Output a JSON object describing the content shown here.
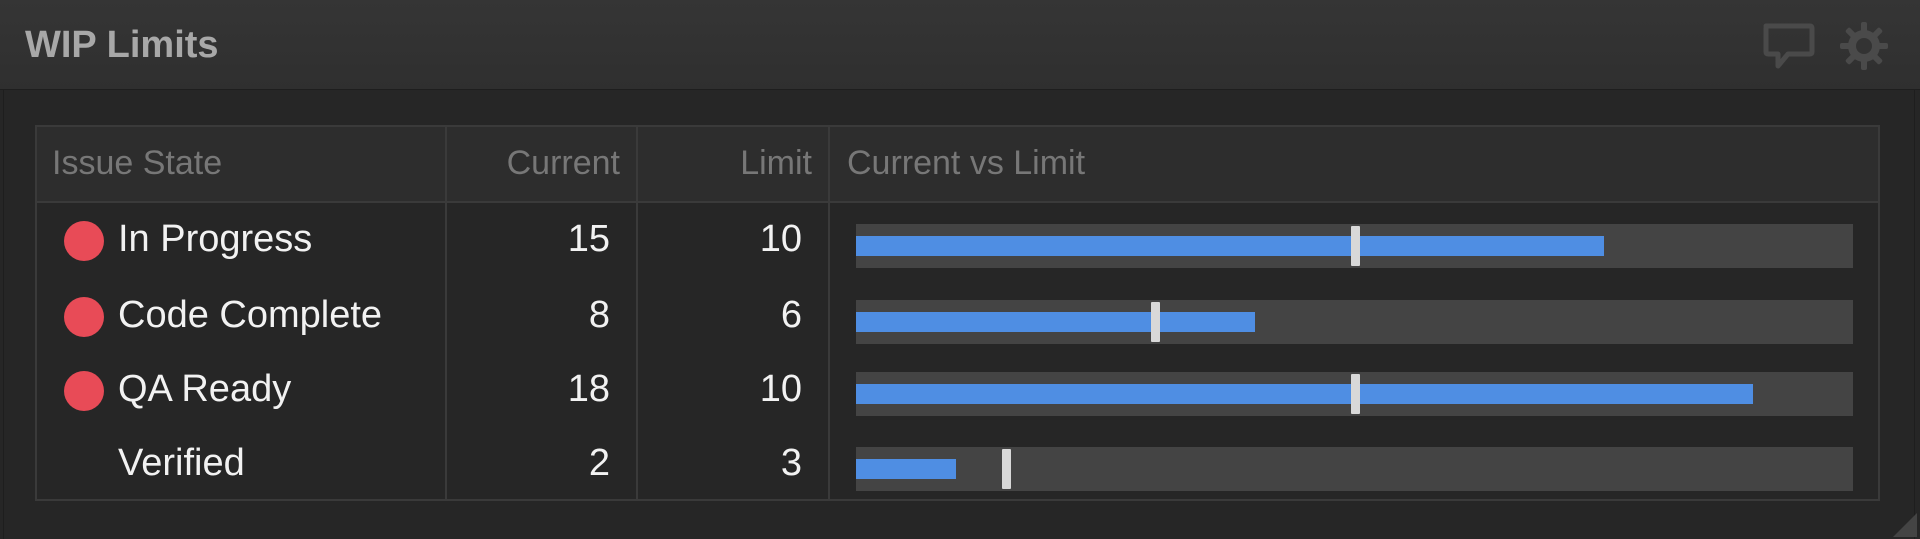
{
  "widget": {
    "title": "WIP Limits",
    "icons": {
      "comment": "comment-icon",
      "settings": "gear-icon"
    }
  },
  "table": {
    "headers": {
      "state": "Issue State",
      "current": "Current",
      "limit": "Limit",
      "bar": "Current vs Limit"
    },
    "rows": [
      {
        "state": "In Progress",
        "current": "15",
        "limit": "10",
        "over_limit": true
      },
      {
        "state": "Code Complete",
        "current": "8",
        "limit": "6",
        "over_limit": true
      },
      {
        "state": "QA Ready",
        "current": "18",
        "limit": "10",
        "over_limit": true
      },
      {
        "state": "Verified",
        "current": "2",
        "limit": "3",
        "over_limit": false
      }
    ]
  },
  "colors": {
    "over_limit_dot": "#e84b57",
    "bar_fill": "#4f8ee3",
    "bar_track": "#444444",
    "limit_marker": "#d8d8d8"
  },
  "chart_data": {
    "type": "bar",
    "title": "Current vs Limit",
    "categories": [
      "In Progress",
      "Code Complete",
      "QA Ready",
      "Verified"
    ],
    "series": [
      {
        "name": "Current",
        "values": [
          15,
          8,
          18,
          2
        ]
      },
      {
        "name": "Limit",
        "values": [
          10,
          6,
          10,
          3
        ]
      }
    ],
    "xlim": [
      0,
      20
    ],
    "orientation": "horizontal"
  }
}
